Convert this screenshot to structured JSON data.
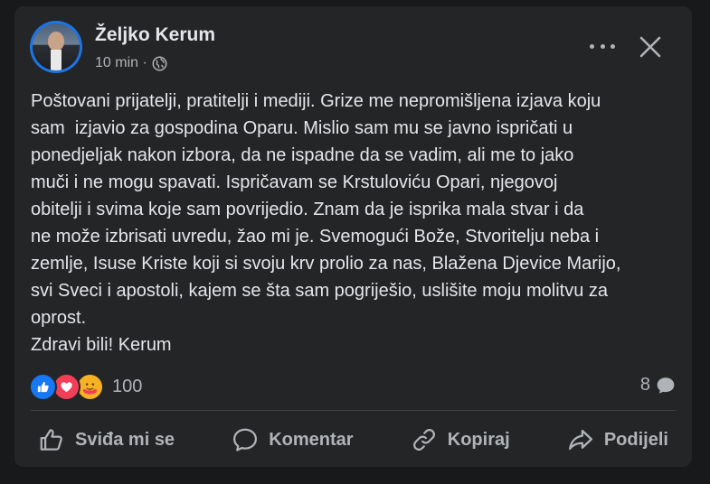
{
  "post": {
    "author": "Željko Kerum",
    "time": "10 min ·",
    "audience_icon": "globe-icon",
    "body": "Poštovani prijatelji, pratitelji i mediji. Grize me nepromišljena izjava koju\nsam  izjavio za gospodina Oparu. Mislio sam mu se javno ispričati u\nponedjeljak nakon izbora, da ne ispadne da se vadim, ali me to jako\nmuči i ne mogu spavati. Ispričavam se Krstuloviću Opari, njegovoj\nobitelji i svima koje sam povrijedio. Znam da je isprika mala stvar i da\nne može izbrisati uvredu, žao mi je. Svemogući Bože, Stvoritelju neba i\nzemlje, Isuse Kriste koji si svoju krv prolio za nas, Blažena Djevice Marijo,\nsvi Sveci i apostoli, kajem se šta sam pogriješio, uslišite moju molitvu za\noprost.\nZdravi bili! Kerum",
    "reactions_count": "100",
    "comments_count": "8"
  },
  "actions": {
    "like": "Sviđa mi se",
    "comment": "Komentar",
    "copy": "Kopiraj",
    "share": "Podijeli"
  },
  "colors": {
    "background": "#18191a",
    "card": "#242526",
    "text": "#e4e6eb",
    "muted": "#b0b3b8",
    "like": "#1877f2",
    "love": "#f33e58",
    "care": "#f7b125"
  }
}
